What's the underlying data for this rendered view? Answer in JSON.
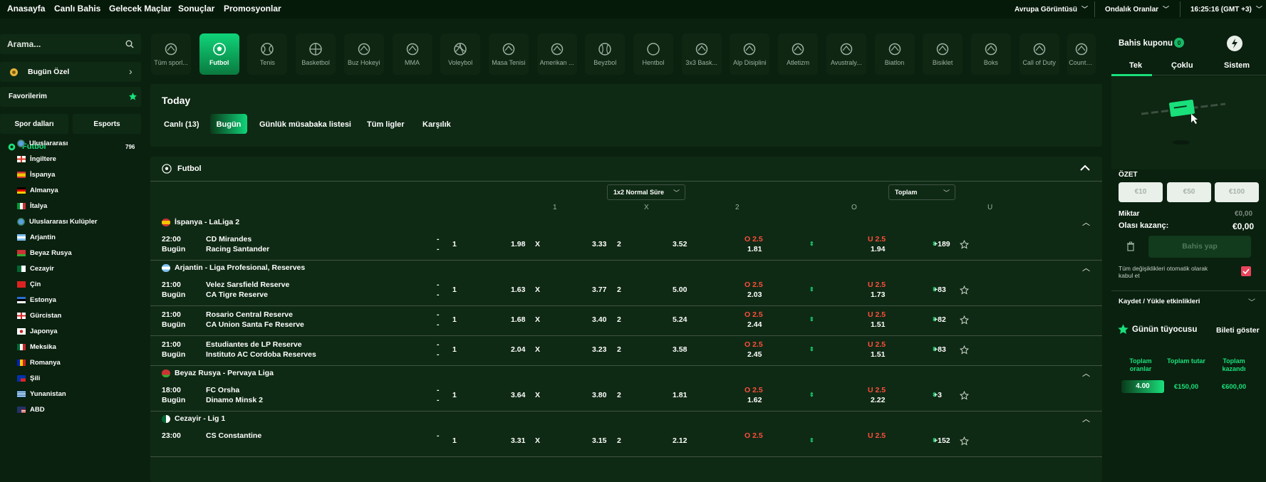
{
  "nav": {
    "links": [
      "Anasayfa",
      "Canlı Bahis",
      "Gelecek Maçlar",
      "Sonuçlar",
      "Promosyonlar"
    ],
    "view_select": "Avrupa Görüntüsü",
    "odds_select": "Ondalık Oranlar",
    "clock": "16:25:16 (GMT +3)"
  },
  "sidebar": {
    "search_placeholder": "Arama...",
    "special": "Bugün Özel",
    "favorites": "Favorilerim",
    "tab_sports": "Spor dalları",
    "tab_esports": "Esports",
    "sport": "Futbol",
    "sport_count": "796",
    "countries": [
      "Uluslararası",
      "İngiltere",
      "İspanya",
      "Almanya",
      "İtalya",
      "Uluslararası Kulüpler",
      "Arjantin",
      "Beyaz Rusya",
      "Cezayir",
      "Çin",
      "Estonya",
      "Gürcistan",
      "Japonya",
      "Meksika",
      "Romanya",
      "Şili",
      "Yunanistan",
      "ABD"
    ]
  },
  "sports": [
    {
      "label": "Tüm sporl...",
      "icon": "all-sports-icon"
    },
    {
      "label": "Futbol",
      "icon": "soccer-ball-icon",
      "active": true
    },
    {
      "label": "Tenis",
      "icon": "tennis-ball-icon"
    },
    {
      "label": "Basketbol",
      "icon": "basketball-icon"
    },
    {
      "label": "Buz Hokeyi",
      "icon": "ice-hockey-icon"
    },
    {
      "label": "MMA",
      "icon": "mma-icon"
    },
    {
      "label": "Voleybol",
      "icon": "volleyball-icon"
    },
    {
      "label": "Masa Tenisi",
      "icon": "table-tennis-icon"
    },
    {
      "label": "Amerikan ...",
      "icon": "american-football-icon"
    },
    {
      "label": "Beyzbol",
      "icon": "baseball-icon"
    },
    {
      "label": "Hentbol",
      "icon": "handball-icon"
    },
    {
      "label": "3x3 Bask...",
      "icon": "basketball-3x3-icon"
    },
    {
      "label": "Alp Disiplini",
      "icon": "alpine-skiing-icon"
    },
    {
      "label": "Atletizm",
      "icon": "athletics-icon"
    },
    {
      "label": "Avustraly...",
      "icon": "aussie-rules-icon"
    },
    {
      "label": "Biatlon",
      "icon": "biathlon-icon"
    },
    {
      "label": "Bisiklet",
      "icon": "cycling-icon"
    },
    {
      "label": "Boks",
      "icon": "boxing-icon"
    },
    {
      "label": "Call of Duty",
      "icon": "call-of-duty-icon"
    },
    {
      "label": "Counter-S",
      "icon": "counter-strike-icon"
    }
  ],
  "today": {
    "title": "Today",
    "tabs": [
      "Canlı (13)",
      "Bugün",
      "Günlük müsabaka listesi",
      "Tüm ligler",
      "Karşılık"
    ]
  },
  "table": {
    "sport": "Futbol",
    "market_1x2": "1x2 Normal Süre",
    "market_total": "Toplam",
    "col_1": "1",
    "col_x": "X",
    "col_2": "2",
    "col_o": "O",
    "col_u": "U",
    "leagues": [
      {
        "name": "İspanya - LaLiga 2",
        "matches": [
          {
            "time": "22:00",
            "day": "Bugün",
            "home": "CD Mirandes",
            "away": "Racing Santander",
            "s1": "-",
            "s2": "-",
            "l1": "1",
            "o1": "1.98",
            "lx": "X",
            "ox": "3.33",
            "l2": "2",
            "o2": "3.52",
            "ol": "O 2.5",
            "ov": "1.81",
            "ul": "U 2.5",
            "uv": "1.94",
            "more": "+189"
          }
        ]
      },
      {
        "name": "Arjantin - Liga Profesional, Reserves",
        "matches": [
          {
            "time": "21:00",
            "day": "Bugün",
            "home": "Velez Sarsfield Reserve",
            "away": "CA Tigre Reserve",
            "s1": "-",
            "s2": "-",
            "l1": "1",
            "o1": "1.63",
            "lx": "X",
            "ox": "3.77",
            "l2": "2",
            "o2": "5.00",
            "ol": "O 2.5",
            "ov": "2.03",
            "ul": "U 2.5",
            "uv": "1.73",
            "more": "+83"
          },
          {
            "time": "21:00",
            "day": "Bugün",
            "home": "Rosario Central Reserve",
            "away": "CA Union Santa Fe Reserve",
            "s1": "-",
            "s2": "-",
            "l1": "1",
            "o1": "1.68",
            "lx": "X",
            "ox": "3.40",
            "l2": "2",
            "o2": "5.24",
            "ol": "O 2.5",
            "ov": "2.44",
            "ul": "U 2.5",
            "uv": "1.51",
            "more": "+82"
          },
          {
            "time": "21:00",
            "day": "Bugün",
            "home": "Estudiantes de LP Reserve",
            "away": "Instituto AC Cordoba Reserves",
            "s1": "-",
            "s2": "-",
            "l1": "1",
            "o1": "2.04",
            "lx": "X",
            "ox": "3.23",
            "l2": "2",
            "o2": "3.58",
            "ol": "O 2.5",
            "ov": "2.45",
            "ul": "U 2.5",
            "uv": "1.51",
            "more": "+83"
          }
        ]
      },
      {
        "name": "Beyaz Rusya - Pervaya Liga",
        "matches": [
          {
            "time": "18:00",
            "day": "Bugün",
            "home": "FC Orsha",
            "away": "Dinamo Minsk 2",
            "s1": "-",
            "s2": "-",
            "l1": "1",
            "o1": "3.64",
            "lx": "X",
            "ox": "3.80",
            "l2": "2",
            "o2": "1.81",
            "ol": "O 2.5",
            "ov": "1.62",
            "ul": "U 2.5",
            "uv": "2.22",
            "more": "+3"
          }
        ]
      },
      {
        "name": "Cezayir - Lig 1",
        "matches": [
          {
            "time": "23:00",
            "day": "",
            "home": "CS Constantine",
            "away": "",
            "s1": "-",
            "s2": "",
            "l1": "1",
            "o1": "3.31",
            "lx": "X",
            "ox": "3.15",
            "l2": "2",
            "o2": "2.12",
            "ol": "O 2.5",
            "ov": "",
            "ul": "U 2.5",
            "uv": "",
            "more": "+152"
          }
        ]
      }
    ]
  },
  "coupon": {
    "title": "Bahis kuponu",
    "count": "0",
    "tabs": [
      "Tek",
      "Çoklu",
      "Sistem"
    ],
    "summary": "ÖZET",
    "quick": [
      "€10",
      "€50",
      "€100"
    ],
    "amount_label": "Miktar",
    "amount": "€0,00",
    "win_label": "Olası kazanç:",
    "win": "€0,00",
    "place": "Bahis yap",
    "accept": "Tüm değişiklikleri otomatik olarak kabul et",
    "save_load": "Kaydet / Yükle etkinlikleri",
    "tipster": "Günün tüyocusu",
    "show_ticket": "Bileti göster",
    "stat_labels": [
      "Toplam oranlar",
      "Toplam tutar",
      "Toplam kazandı"
    ],
    "stat_values": [
      "4.00",
      "€150,00",
      "€600,00"
    ]
  }
}
